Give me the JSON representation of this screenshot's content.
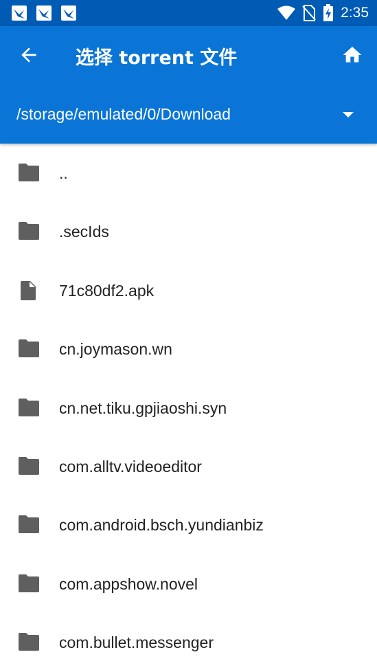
{
  "status_bar": {
    "time": "2:35",
    "notification_icons": [
      "bird-notification-icon",
      "bird-notification-icon",
      "bird-notification-icon"
    ],
    "system_icons": [
      "wifi-icon",
      "no-sim-icon",
      "battery-charging-icon"
    ]
  },
  "app_bar": {
    "title": "选择 torrent 文件",
    "back_icon": "arrow-left-icon",
    "home_icon": "home-icon",
    "path": "/storage/emulated/0/Download",
    "colors": {
      "primary": "#0a75d6",
      "status_bar": "#005bb5",
      "icon": "#5f5f5f"
    }
  },
  "files": [
    {
      "name": "..",
      "type": "folder"
    },
    {
      "name": ".secIds",
      "type": "folder"
    },
    {
      "name": "71c80df2.apk",
      "type": "file"
    },
    {
      "name": "cn.joymason.wn",
      "type": "folder"
    },
    {
      "name": "cn.net.tiku.gpjiaoshi.syn",
      "type": "folder"
    },
    {
      "name": "com.alltv.videoeditor",
      "type": "folder"
    },
    {
      "name": "com.android.bsch.yundianbiz",
      "type": "folder"
    },
    {
      "name": "com.appshow.novel",
      "type": "folder"
    },
    {
      "name": "com.bullet.messenger",
      "type": "folder"
    }
  ]
}
